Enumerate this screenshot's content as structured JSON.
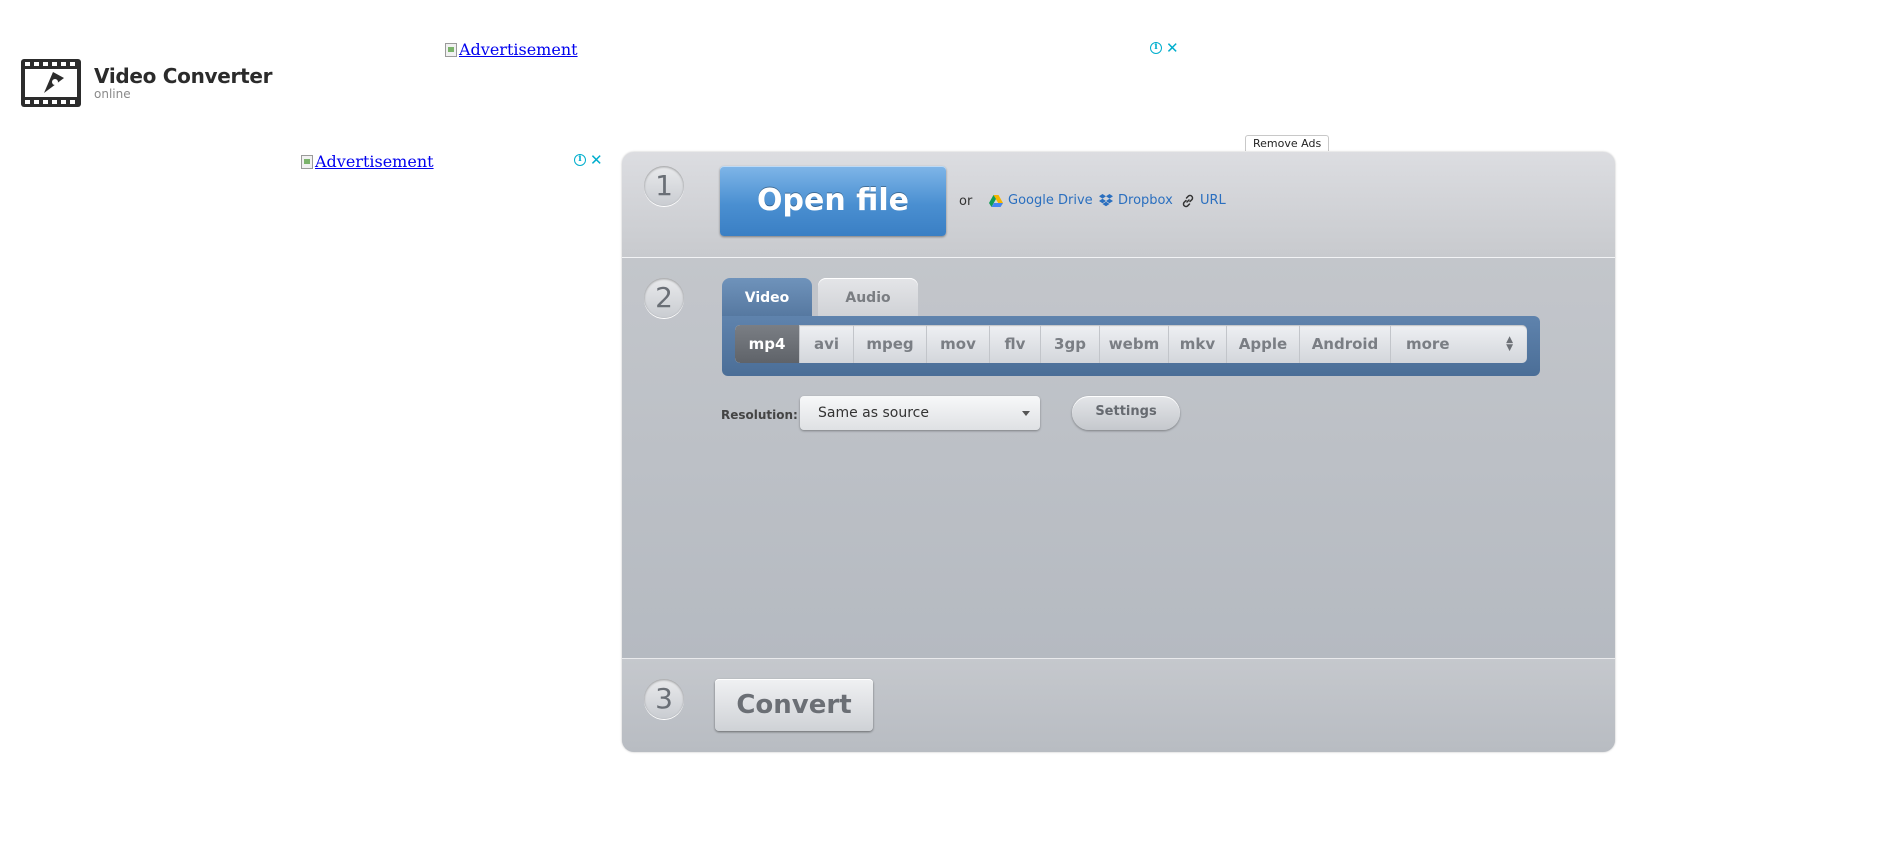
{
  "brand": {
    "title": "Video Converter",
    "subtitle": "online"
  },
  "ads": {
    "top_alt": "Advertisement",
    "side_alt": "Advertisement",
    "info_glyph": "i",
    "close_glyph": "✕",
    "remove_ads": "Remove Ads"
  },
  "step1": {
    "number": "1",
    "open_file": "Open file",
    "or": "or",
    "sources": [
      {
        "label": "Google Drive",
        "icon": "google-drive-icon"
      },
      {
        "label": "Dropbox",
        "icon": "dropbox-icon"
      },
      {
        "label": "URL",
        "icon": "link-icon"
      }
    ]
  },
  "step2": {
    "number": "2",
    "tabs": [
      {
        "label": "Video",
        "active": true
      },
      {
        "label": "Audio",
        "active": false
      }
    ],
    "formats": [
      "mp4",
      "avi",
      "mpeg",
      "mov",
      "flv",
      "3gp",
      "webm",
      "mkv",
      "Apple",
      "Android",
      "more"
    ],
    "selected_format": "mp4",
    "resolution_label": "Resolution:",
    "resolution_value": "Same as source",
    "settings_label": "Settings"
  },
  "step3": {
    "number": "3",
    "convert_label": "Convert"
  },
  "colors": {
    "accent_blue": "#4a8fd1",
    "tab_blue": "#5f83ad",
    "link_blue": "#2a6fbf"
  }
}
